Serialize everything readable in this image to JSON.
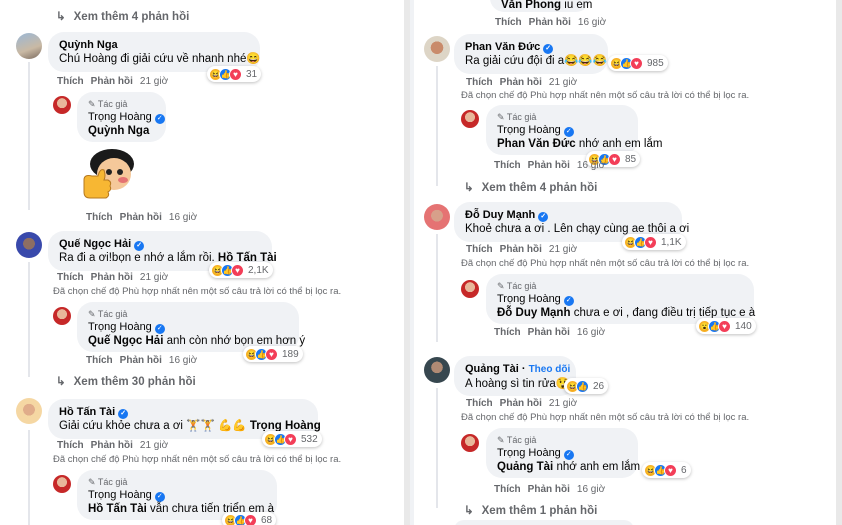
{
  "labels": {
    "like": "Thích",
    "reply": "Phản hồi",
    "author": "Tác giả",
    "filter_note": "Đã chọn chế độ Phù hợp nhất nên một số câu trả lời có thể bị lọc ra.",
    "follow": "Theo dõi"
  },
  "left": {
    "more_top": "Xem thêm 4 phản hồi",
    "c1": {
      "name": "Quỳnh Nga",
      "text": "Chú Hoàng đi giải cứu về nhanh nhé😄",
      "time": "21 giờ",
      "reacts": "31"
    },
    "r1": {
      "name": "Trọng Hoàng",
      "mention": "Quỳnh Nga",
      "time": "16 giờ"
    },
    "c2": {
      "name": "Quế Ngọc Hải",
      "text": "Ra đi a ơi!bọn e nhớ a lắm rồi.",
      "mention": "Hồ Tấn Tài",
      "time": "21 giờ",
      "reacts": "2,1K"
    },
    "r2": {
      "name": "Trọng Hoàng",
      "mention": "Quế Ngọc Hải",
      "text": "anh còn nhớ bọn em hơn ý",
      "time": "16 giờ",
      "reacts": "189"
    },
    "more_mid": "Xem thêm 30 phản hồi",
    "c3": {
      "name": "Hồ Tấn Tài",
      "text": "Giải cứu khỏe chưa a ơi 🏋🏋 💪💪",
      "mention": "Trọng Hoàng",
      "time": "21 giờ",
      "reacts": "532"
    },
    "r3": {
      "name": "Trọng Hoàng",
      "mention": "Hồ Tấn Tài",
      "text": "vẫn chưa tiến triển em à",
      "reacts": "68"
    }
  },
  "right": {
    "top_name": "Văn Phong",
    "top_text": "iu em",
    "top_time": "16 giờ",
    "c1": {
      "name": "Phan Văn Đức",
      "text": "Ra giải cứu đội đi a😂😂😂",
      "time": "21 giờ",
      "reacts": "985"
    },
    "r1": {
      "name": "Trọng Hoàng",
      "mention": "Phan Văn Đức",
      "text": "nhớ anh em lắm",
      "time": "16 giờ",
      "reacts": "85"
    },
    "more_1": "Xem thêm 4 phản hồi",
    "c2": {
      "name": "Đỗ Duy Mạnh",
      "text": "Khoẻ chưa a ơi . Lên chạy cùng ae thôi a ơi",
      "time": "21 giờ",
      "reacts": "1,1K"
    },
    "r2": {
      "name": "Trọng Hoàng",
      "mention": "Đỗ Duy Mạnh",
      "text": "chưa e ơi , đang điều trị tiếp tục e à",
      "time": "16 giờ",
      "reacts": "140"
    },
    "c3": {
      "name": "Quảng Tài",
      "text": "A hoàng sì tin rửa😲",
      "time": "21 giờ",
      "reacts": "26"
    },
    "r3": {
      "name": "Trọng Hoàng",
      "mention": "Quảng Tài",
      "text": "nhớ anh em lắm",
      "time": "16 giờ",
      "reacts": "6"
    },
    "more_2": "Xem thêm 1 phản hồi"
  },
  "colors": {
    "accent": "#1877f2",
    "bubble": "#f0f2f5",
    "muted": "#65676b"
  },
  "icons": [
    "reply-arrow-icon",
    "pencil-icon",
    "verified-badge-icon",
    "haha-reaction-icon",
    "like-reaction-icon",
    "love-reaction-icon"
  ]
}
